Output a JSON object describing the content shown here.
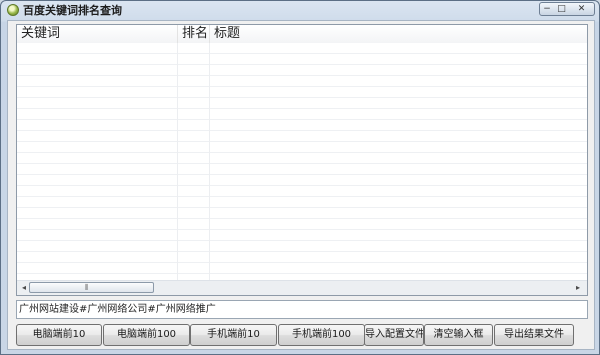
{
  "window": {
    "title": "百度关键词排名查询",
    "minimize_glyph": "−",
    "maximize_glyph": "□",
    "close_glyph": "✕"
  },
  "table": {
    "columns": [
      "关键词",
      "排名",
      "标题"
    ],
    "rows": []
  },
  "scrollbar": {
    "left_arrow": "◂",
    "right_arrow": "▸",
    "grip": "⦀"
  },
  "keyword_input": {
    "value": "广州网站建设#广州网络公司#广州网络推广"
  },
  "buttons": {
    "pc_top10": "电脑端前10",
    "pc_top100": "电脑端前100",
    "mobile_top10": "手机端前10",
    "mobile_top100": "手机端前100",
    "import_config": "导入配置文件",
    "clear_input": "清空输入框",
    "export_result": "导出结果文件"
  }
}
